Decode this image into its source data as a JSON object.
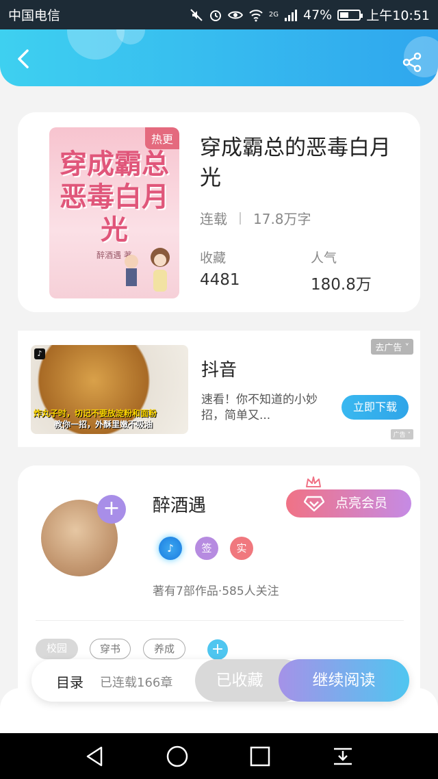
{
  "status_bar": {
    "carrier": "中国电信",
    "network": "2G",
    "battery": "47%",
    "time": "上午10:51",
    "battery_level": 0.47
  },
  "header": {
    "back_icon": "chevron-left-icon",
    "share_icon": "share-icon"
  },
  "book": {
    "title": "穿成霸总的恶毒白月光",
    "cover_title": "穿成霸总恶毒白月光",
    "cover_author": "醉酒遇 著",
    "hot_tag": "热更",
    "status": "连载",
    "word_count": "17.8万字",
    "favorites_label": "收藏",
    "favorites_value": "4481",
    "popularity_label": "人气",
    "popularity_value": "180.8万"
  },
  "ad": {
    "caption_line1": "炸丸子时，切记不要放淀粉和面粉",
    "caption_line2": "教你一招，外酥里嫩不吸油",
    "title": "抖音",
    "description": "速看！你不知道的小妙招，简单又...",
    "download": "立即下载",
    "close": "去广告 ˅",
    "ad_mark": "广告 ˅"
  },
  "author": {
    "name": "醉酒遇",
    "vip_button": "点亮会员",
    "badges": [
      "签",
      "实"
    ],
    "stats": "著有7部作品·585人关注",
    "tags": [
      "校园",
      "穿书",
      "养成"
    ]
  },
  "bottom_bar": {
    "toc": "目录",
    "chapters": "已连载166章",
    "favorited": "已收藏",
    "continue": "继续阅读"
  }
}
